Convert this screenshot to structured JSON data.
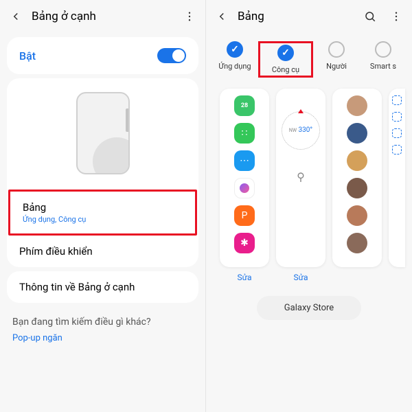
{
  "left": {
    "header": {
      "title": "Bảng ở cạnh"
    },
    "toggle": {
      "label": "Bật",
      "on": true
    },
    "items": {
      "panels": {
        "title": "Bảng",
        "subtitle": "Ứng dụng, Công cụ"
      },
      "handle": {
        "title": "Phím điều khiển"
      },
      "about": {
        "title": "Thông tin về Bảng ở cạnh"
      }
    },
    "lookingFor": {
      "title": "Bạn đang tìm kiếm điều gì khác?",
      "link": "Pop-up ngăn"
    }
  },
  "right": {
    "header": {
      "title": "Bảng"
    },
    "selectors": [
      {
        "label": "Ứng dụng",
        "checked": true
      },
      {
        "label": "Công cụ",
        "checked": true,
        "highlight": true
      },
      {
        "label": "Người",
        "checked": false
      },
      {
        "label": "Smart s",
        "checked": false
      }
    ],
    "edit": "Sửa",
    "compass": {
      "value": "330°",
      "prefix": "NW"
    },
    "galaxyStore": "Galaxy Store",
    "apps": [
      {
        "bg": "#3ac569",
        "glyph": "28"
      },
      {
        "bg": "#34c759",
        "glyph": "∷"
      },
      {
        "bg": "#1a9af0",
        "glyph": "⋯"
      },
      {
        "bg": "#ffffff",
        "glyph": "◉"
      },
      {
        "bg": "#ff6b1a",
        "glyph": "P"
      },
      {
        "bg": "#e91e8c",
        "glyph": "✱"
      }
    ],
    "avatars": [
      "#c79a7a",
      "#3a5a8a",
      "#d4a05a",
      "#7a5a4a",
      "#b87a5a",
      "#8a6a5a"
    ]
  }
}
